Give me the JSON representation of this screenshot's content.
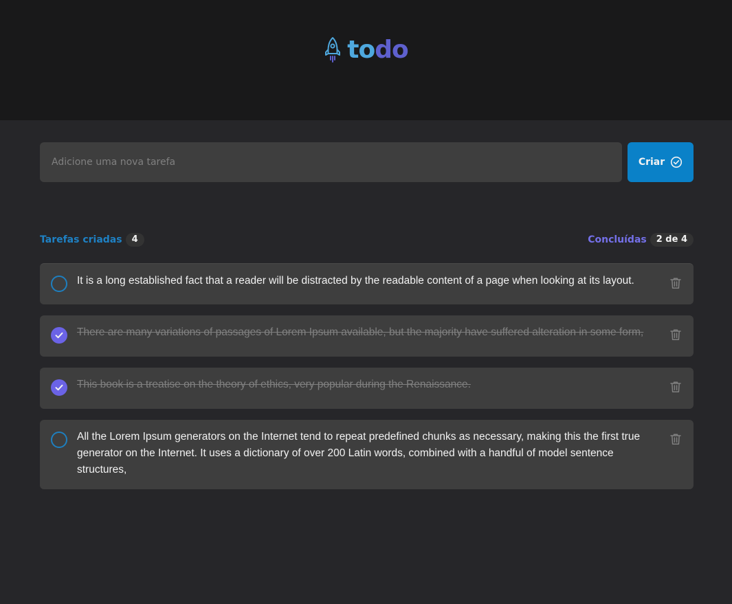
{
  "app": {
    "title_part1": "to",
    "title_part2": "do",
    "logo_icon": "rocket-icon",
    "colors": {
      "primary": "#4ea8de",
      "secondary": "#5e60ce",
      "button": "#0a81c8"
    }
  },
  "new_task": {
    "placeholder": "Adicione uma nova tarefa",
    "value": "",
    "create_label": "Criar",
    "create_icon": "plus-circle-icon"
  },
  "stats": {
    "created_label": "Tarefas criadas",
    "created_count": "4",
    "done_label": "Concluídas",
    "done_count": "2 de 4"
  },
  "tasks": [
    {
      "text": "It is a long established fact that a reader will be distracted by the readable content of a page when looking at its layout.",
      "done": false
    },
    {
      "text": "There are many variations of passages of Lorem Ipsum available, but the majority have suffered alteration in some form,",
      "done": true
    },
    {
      "text": "This book is a treatise on the theory of ethics, very popular during the Renaissance.",
      "done": true
    },
    {
      "text": "All the Lorem Ipsum generators on the Internet tend to repeat predefined chunks as necessary, making this the first true generator on the Internet. It uses a dictionary of over 200 Latin words, combined with a handful of model sentence structures,",
      "done": false
    }
  ]
}
